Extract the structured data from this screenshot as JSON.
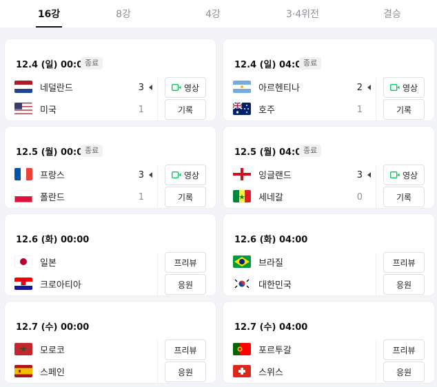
{
  "tabs": [
    "16강",
    "8강",
    "4강",
    "3·4위전",
    "결승"
  ],
  "matches": [
    {
      "date": "12.4 (일) 00:00",
      "status": "종료",
      "team1": {
        "name": "네덜란드",
        "flag": "nl",
        "score": "3"
      },
      "team2": {
        "name": "미국",
        "flag": "us",
        "score": "1"
      },
      "btn1": "영상",
      "btn2": "기록",
      "has_video": true
    },
    {
      "date": "12.4 (일) 04:00",
      "status": "종료",
      "team1": {
        "name": "아르헨티나",
        "flag": "ar",
        "score": "2"
      },
      "team2": {
        "name": "호주",
        "flag": "au",
        "score": "1"
      },
      "btn1": "영상",
      "btn2": "기록",
      "has_video": true
    },
    {
      "date": "12.5 (월) 00:00",
      "status": "종료",
      "team1": {
        "name": "프랑스",
        "flag": "fr",
        "score": "3"
      },
      "team2": {
        "name": "폴란드",
        "flag": "pl",
        "score": "1"
      },
      "btn1": "영상",
      "btn2": "기록",
      "has_video": true
    },
    {
      "date": "12.5 (월) 04:00",
      "status": "종료",
      "team1": {
        "name": "잉글랜드",
        "flag": "en",
        "score": "3"
      },
      "team2": {
        "name": "세네갈",
        "flag": "sn",
        "score": "0"
      },
      "btn1": "영상",
      "btn2": "기록",
      "has_video": true
    },
    {
      "date": "12.6 (화) 00:00",
      "status": "",
      "team1": {
        "name": "일본",
        "flag": "jp",
        "score": ""
      },
      "team2": {
        "name": "크로아티아",
        "flag": "hr",
        "score": ""
      },
      "btn1": "프리뷰",
      "btn2": "응원",
      "has_video": false
    },
    {
      "date": "12.6 (화) 04:00",
      "status": "",
      "team1": {
        "name": "브라질",
        "flag": "br",
        "score": ""
      },
      "team2": {
        "name": "대한민국",
        "flag": "kr",
        "score": ""
      },
      "btn1": "프리뷰",
      "btn2": "응원",
      "has_video": false
    },
    {
      "date": "12.7 (수) 00:00",
      "status": "",
      "team1": {
        "name": "모로코",
        "flag": "ma",
        "score": ""
      },
      "team2": {
        "name": "스페인",
        "flag": "es",
        "score": ""
      },
      "btn1": "프리뷰",
      "btn2": "응원",
      "has_video": false
    },
    {
      "date": "12.7 (수) 04:00",
      "status": "",
      "team1": {
        "name": "포르투갈",
        "flag": "pt",
        "score": ""
      },
      "team2": {
        "name": "스위스",
        "flag": "ch",
        "score": ""
      },
      "btn1": "프리뷰",
      "btn2": "응원",
      "has_video": false
    }
  ],
  "colors": {
    "video_icon": "#03c75a",
    "active_tab": "#111111",
    "inactive_tab": "#8b8f96"
  }
}
